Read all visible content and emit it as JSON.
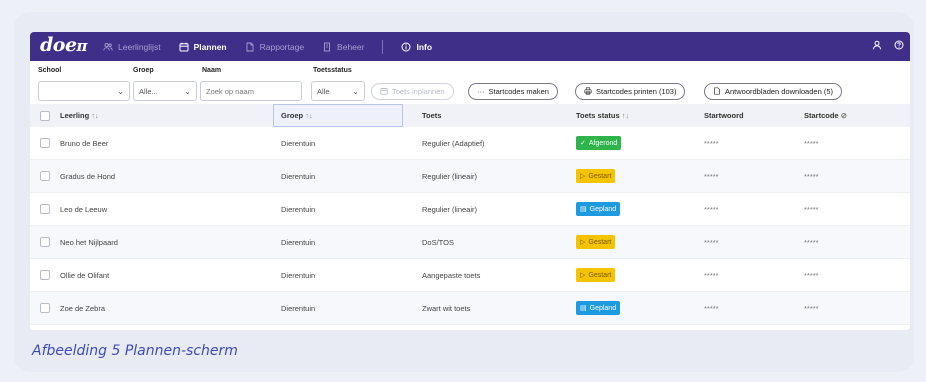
{
  "brand": {
    "logo": "doe",
    "accent": "#3f2f88"
  },
  "nav": {
    "items": [
      {
        "label": "Leerlinglijst",
        "icon": "users-icon",
        "active": false
      },
      {
        "label": "Plannen",
        "icon": "calendar-icon",
        "active": true
      },
      {
        "label": "Rapportage",
        "icon": "document-icon",
        "active": false
      },
      {
        "label": "Beheer",
        "icon": "building-icon",
        "active": false
      }
    ],
    "info": "Info",
    "right_icons": [
      "user-icon",
      "help-icon"
    ]
  },
  "filters": {
    "school": {
      "label": "School",
      "value": ""
    },
    "groep": {
      "label": "Groep",
      "value": "Alle..."
    },
    "naam": {
      "label": "Naam",
      "placeholder": "Zoek op naam"
    },
    "toetsstatus": {
      "label": "Toetsstatus",
      "value": "Alle"
    }
  },
  "actions": {
    "toets_inplannen": "Toets inplannen",
    "startcodes_maken": "Startcodes maken",
    "startcodes_printen": "Startcodes printen (103)",
    "antwoordbladen": "Antwoordbladen downloaden (5)"
  },
  "table": {
    "columns": {
      "leerling": "Leerling",
      "groep": "Groep",
      "toets": "Toets",
      "status": "Toets status",
      "startwoord": "Startwoord",
      "startcode": "Startcode"
    },
    "rows": [
      {
        "leerling": "Bruno de Beer",
        "groep": "Dierentuin",
        "toets": "Regulier (Adaptief)",
        "status": "Afgerond",
        "startwoord": "*****",
        "startcode": "*****"
      },
      {
        "leerling": "Gradus de Hond",
        "groep": "Dierentuin",
        "toets": "Regulier (lineair)",
        "status": "Gestart",
        "startwoord": "*****",
        "startcode": "*****"
      },
      {
        "leerling": "Leo de Leeuw",
        "groep": "Dierentuin",
        "toets": "Regulier (lineair)",
        "status": "Gepland",
        "startwoord": "*****",
        "startcode": "*****"
      },
      {
        "leerling": "Neo het Nijlpaard",
        "groep": "Dierentuin",
        "toets": "DoS/TOS",
        "status": "Gestart",
        "startwoord": "*****",
        "startcode": "*****"
      },
      {
        "leerling": "Ollie de Olifant",
        "groep": "Dierentuin",
        "toets": "Aangepaste toets",
        "status": "Gestart",
        "startwoord": "*****",
        "startcode": "*****"
      },
      {
        "leerling": "Zoe de Zebra",
        "groep": "Dierentuin",
        "toets": "Zwart wit toets",
        "status": "Gepland",
        "startwoord": "*****",
        "startcode": "*****"
      }
    ]
  },
  "status_colors": {
    "Afgerond": "#2fb44b",
    "Gestart": "#f5c400",
    "Gepland": "#1e9be0"
  },
  "caption": "Afbeelding 5 Plannen-scherm"
}
